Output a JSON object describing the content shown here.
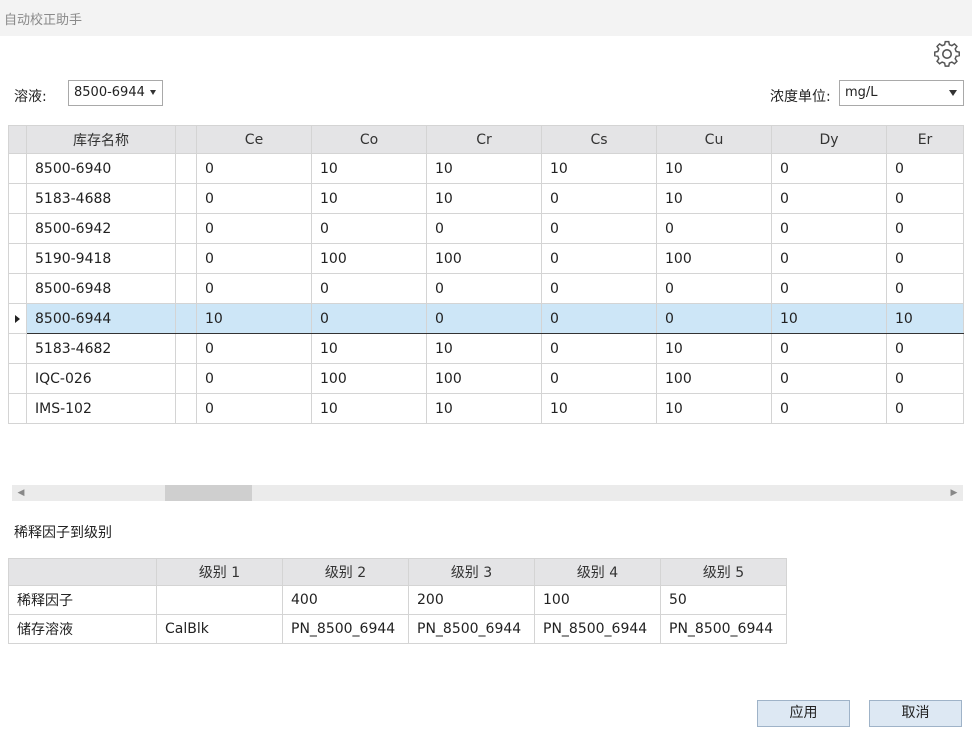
{
  "window": {
    "title": "自动校正助手"
  },
  "solution": {
    "label": "溶液:",
    "value": "8500-6944"
  },
  "unit": {
    "label": "浓度单位:",
    "value": "mg/L"
  },
  "grid": {
    "name_header": "库存名称",
    "columns": [
      "Ce",
      "Co",
      "Cr",
      "Cs",
      "Cu",
      "Dy",
      "Er"
    ],
    "active_row": 5,
    "rows": [
      {
        "name": "8500-6940",
        "values": [
          "0",
          "10",
          "10",
          "10",
          "10",
          "0",
          "0"
        ]
      },
      {
        "name": "5183-4688",
        "values": [
          "0",
          "10",
          "10",
          "0",
          "10",
          "0",
          "0"
        ]
      },
      {
        "name": "8500-6942",
        "values": [
          "0",
          "0",
          "0",
          "0",
          "0",
          "0",
          "0"
        ]
      },
      {
        "name": "5190-9418",
        "values": [
          "0",
          "100",
          "100",
          "0",
          "100",
          "0",
          "0"
        ]
      },
      {
        "name": "8500-6948",
        "values": [
          "0",
          "0",
          "0",
          "0",
          "0",
          "0",
          "0"
        ]
      },
      {
        "name": "8500-6944",
        "values": [
          "10",
          "0",
          "0",
          "0",
          "0",
          "10",
          "10"
        ]
      },
      {
        "name": "5183-4682",
        "values": [
          "0",
          "10",
          "10",
          "0",
          "10",
          "0",
          "0"
        ]
      },
      {
        "name": "IQC-026",
        "values": [
          "0",
          "100",
          "100",
          "0",
          "100",
          "0",
          "0"
        ]
      },
      {
        "name": "IMS-102",
        "values": [
          "0",
          "10",
          "10",
          "10",
          "10",
          "0",
          "0"
        ]
      }
    ]
  },
  "dilution": {
    "section_title": "稀释因子到级别",
    "levels": [
      "级别 1",
      "级别 2",
      "级别 3",
      "级别 4",
      "级别 5"
    ],
    "rows": [
      {
        "label": "稀释因子",
        "values": [
          "",
          "400",
          "200",
          "100",
          "50"
        ]
      },
      {
        "label": "储存溶液",
        "values": [
          "CalBlk",
          "PN_8500_6944",
          "PN_8500_6944",
          "PN_8500_6944",
          "PN_8500_6944"
        ]
      }
    ]
  },
  "buttons": {
    "apply": "应用",
    "cancel": "取消"
  },
  "icons": {
    "settings": "gear-icon",
    "scroll_left": "chevron-left-icon",
    "scroll_right": "chevron-right-icon"
  },
  "colors": {
    "selected_row": "#cde6f7",
    "header_bg": "#e4e4e6",
    "button_bg": "#dde8f3"
  }
}
